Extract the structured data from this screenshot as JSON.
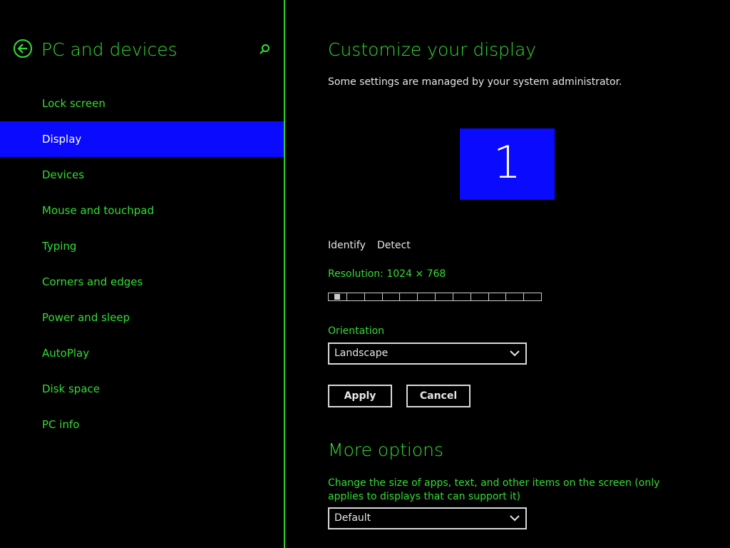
{
  "sidebar": {
    "title": "PC and devices",
    "items": [
      {
        "label": "Lock screen"
      },
      {
        "label": "Display",
        "selected": true
      },
      {
        "label": "Devices"
      },
      {
        "label": "Mouse and touchpad"
      },
      {
        "label": "Typing"
      },
      {
        "label": "Corners and edges"
      },
      {
        "label": "Power and sleep"
      },
      {
        "label": "AutoPlay"
      },
      {
        "label": "Disk space"
      },
      {
        "label": "PC info"
      }
    ]
  },
  "main": {
    "title": "Customize your display",
    "admin_note": "Some settings are managed by your system administrator.",
    "monitor_number": "1",
    "identify_label": "Identify",
    "detect_label": "Detect",
    "resolution_label": "Resolution: 1024 × 768",
    "resolution_slider": {
      "steps": 12,
      "selected_index": 0
    },
    "orientation_label": "Orientation",
    "orientation_value": "Landscape",
    "apply_label": "Apply",
    "cancel_label": "Cancel",
    "more_options_title": "More options",
    "scale_description": "Change the size of apps, text, and other items on the screen (only applies to displays that can support it)",
    "scale_value": "Default"
  },
  "colors": {
    "accent": "#33dd33",
    "selection": "#0a0aff",
    "background": "#000000"
  }
}
